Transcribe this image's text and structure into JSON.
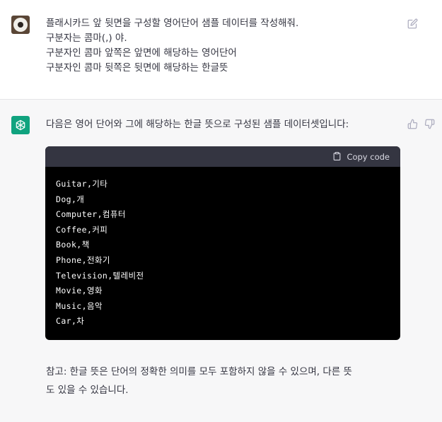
{
  "user_message": {
    "lines": [
      "플래시카드 앞 뒷면을 구성할 영어단어 샘플 데이터를 작성해줘.",
      "구분자는 콤마(,) 야.",
      "구분자인 콤마 앞쪽은 앞면에 해당하는 영어단어",
      "구분자인 콤마 뒷쪽은 뒷면에 해당하는 한글뜻"
    ]
  },
  "assistant_message": {
    "intro": "다음은 영어 단어와 그에 해당하는 한글 뜻으로 구성된 샘플 데이터셋입니다:",
    "code": {
      "copy_label": "Copy code",
      "lines": [
        "Guitar,기타",
        "Dog,개",
        "Computer,컴퓨터",
        "Coffee,커피",
        "Book,책",
        "Phone,전화기",
        "Television,텔레비전",
        "Movie,영화",
        "Music,음악",
        "Car,차"
      ]
    },
    "note_lines": [
      "참고: 한글 뜻은 단어의 정확한 의미를 모두 포함하지 않을 수 있으며, 다른 뜻",
      "도 있을 수 있습니다."
    ]
  },
  "icons": {
    "edit": "edit-icon",
    "copy": "clipboard-icon",
    "thumb_up": "thumbs-up-icon",
    "thumb_down": "thumbs-down-icon",
    "assistant_logo": "openai-logo-icon"
  },
  "colors": {
    "assistant_avatar": "#10a37f",
    "code_background": "#000000",
    "code_header": "#343541"
  }
}
